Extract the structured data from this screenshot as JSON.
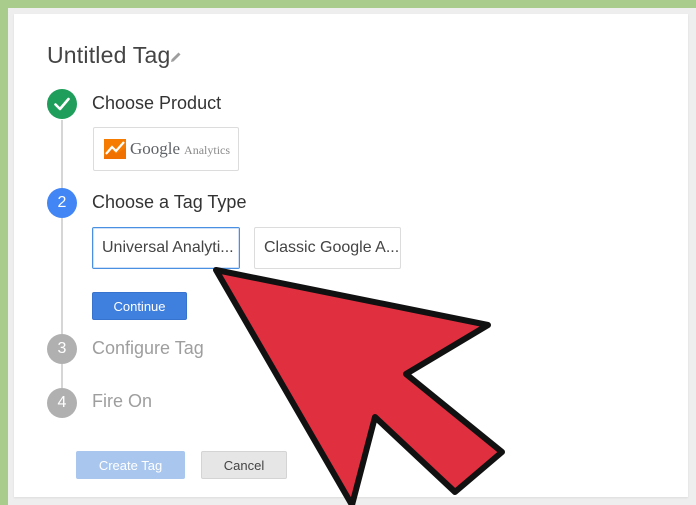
{
  "title": "Untitled Tag",
  "steps": [
    {
      "number": "",
      "label": "Choose Product",
      "state": "complete"
    },
    {
      "number": "2",
      "label": "Choose a Tag Type",
      "state": "active"
    },
    {
      "number": "3",
      "label": "Configure Tag",
      "state": "disabled"
    },
    {
      "number": "4",
      "label": "Fire On",
      "state": "disabled"
    }
  ],
  "product": {
    "google": "Google",
    "analytics": "Analytics"
  },
  "tag_types": [
    "Universal Analyti...",
    "Classic Google A..."
  ],
  "buttons": {
    "continue": "Continue",
    "create": "Create Tag",
    "cancel": "Cancel"
  },
  "colors": {
    "complete": "#1e9e5a",
    "active": "#4285f4",
    "disabled": "#b0b0b0",
    "arrow": "#e03040"
  }
}
